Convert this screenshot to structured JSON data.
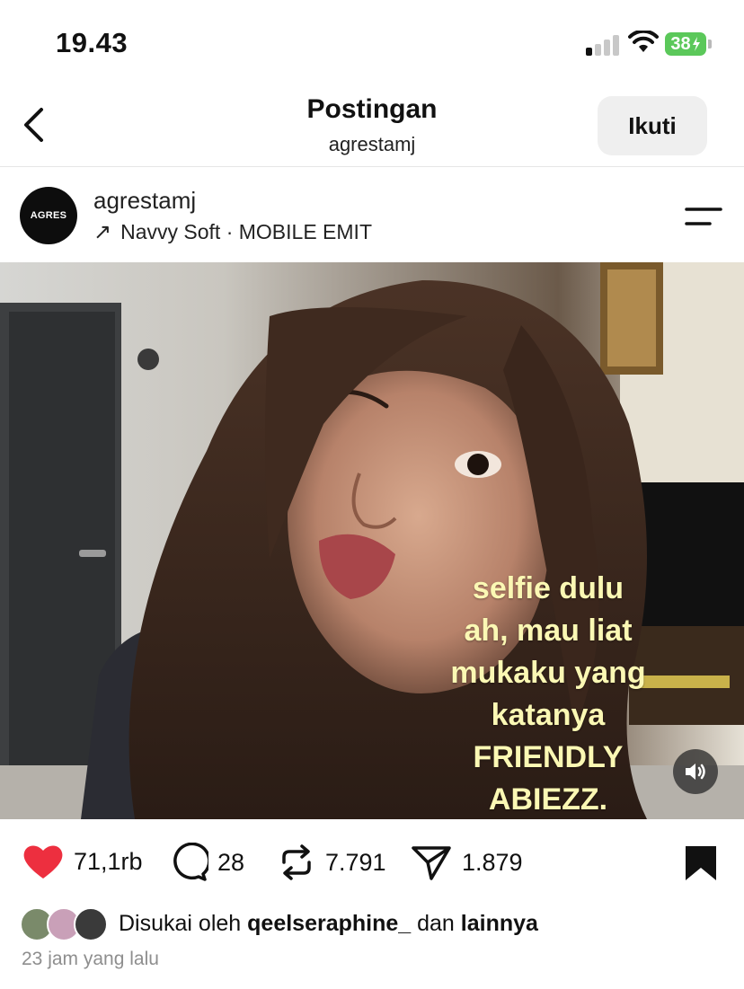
{
  "status_bar": {
    "time": "19.43",
    "battery": "38",
    "signal_bars_on": 1,
    "signal_bars_total": 4
  },
  "header": {
    "title": "Postingan",
    "subtitle": "agrestamj",
    "follow_label": "Ikuti",
    "back_icon": "chevron-left-icon"
  },
  "post": {
    "avatar_text": "AGRES",
    "username": "agrestamj",
    "music_arrow": "↗",
    "music": "Navvy Soft · MOBILE EMIT",
    "menu_icon": "menu-icon",
    "caption_lines": [
      "selfie dulu",
      "ah, mau liat",
      "mukaku yang",
      "katanya",
      "FRIENDLY",
      "ABIEZZ."
    ],
    "caption_color": "#fbf8b4"
  },
  "actions": {
    "likes": "71,1rb",
    "comments": "28",
    "reposts": "7.791",
    "shares": "1.879",
    "like_color": "#ed2f3f"
  },
  "liked_by": {
    "prefix": "Disukai oleh",
    "user": "qeelseraphine_",
    "conjunction": "dan",
    "others": "lainnya"
  },
  "timestamp": "23 jam yang lalu"
}
